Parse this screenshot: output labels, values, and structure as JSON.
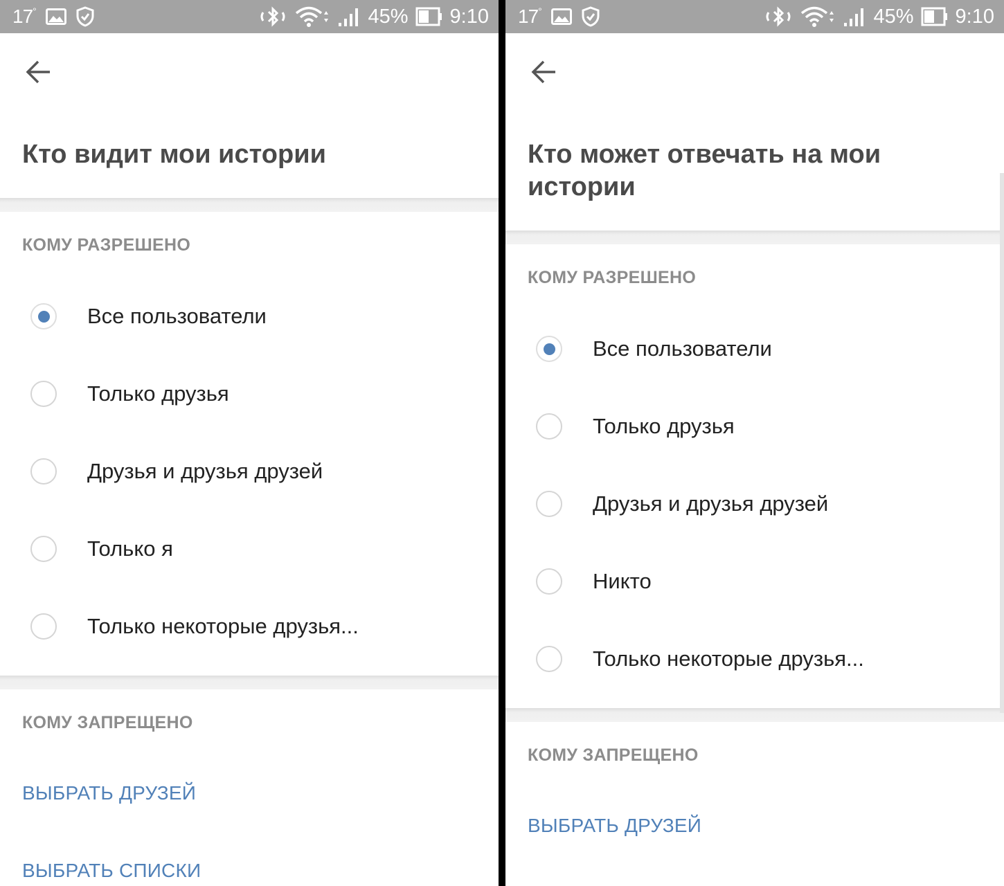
{
  "status_bar": {
    "temperature": "17",
    "degree": "°",
    "battery": "45%",
    "time": "9:10"
  },
  "icons": {
    "back": "arrow-left-icon",
    "status": [
      "image-icon",
      "shield-check-icon",
      "bluetooth-icon",
      "wifi-icon",
      "signal-icon",
      "battery-icon"
    ]
  },
  "colors": {
    "accent": "#5181b8",
    "status_bar": "#a3a3a3",
    "section_label": "#8c8c8c",
    "title": "#4a4a4a"
  },
  "left": {
    "title": "Кто видит мои истории",
    "allowed_label": "КОМУ РАЗРЕШЕНО",
    "options": [
      {
        "label": "Все пользователи",
        "selected": true
      },
      {
        "label": "Только друзья",
        "selected": false
      },
      {
        "label": "Друзья и друзья друзей",
        "selected": false
      },
      {
        "label": "Только я",
        "selected": false
      },
      {
        "label": "Только некоторые друзья...",
        "selected": false
      }
    ],
    "denied_label": "КОМУ ЗАПРЕЩЕНО",
    "select_friends": "ВЫБРАТЬ ДРУЗЕЙ",
    "select_lists": "ВЫБРАТЬ СПИСКИ"
  },
  "right": {
    "title_line1": "Кто может отвечать на мои",
    "title_line2": "истории",
    "allowed_label": "КОМУ РАЗРЕШЕНО",
    "options": [
      {
        "label": "Все пользователи",
        "selected": true
      },
      {
        "label": "Только друзья",
        "selected": false
      },
      {
        "label": "Друзья и друзья друзей",
        "selected": false
      },
      {
        "label": "Никто",
        "selected": false
      },
      {
        "label": "Только некоторые друзья...",
        "selected": false
      }
    ],
    "denied_label": "КОМУ ЗАПРЕЩЕНО",
    "select_friends": "ВЫБРАТЬ ДРУЗЕЙ"
  }
}
